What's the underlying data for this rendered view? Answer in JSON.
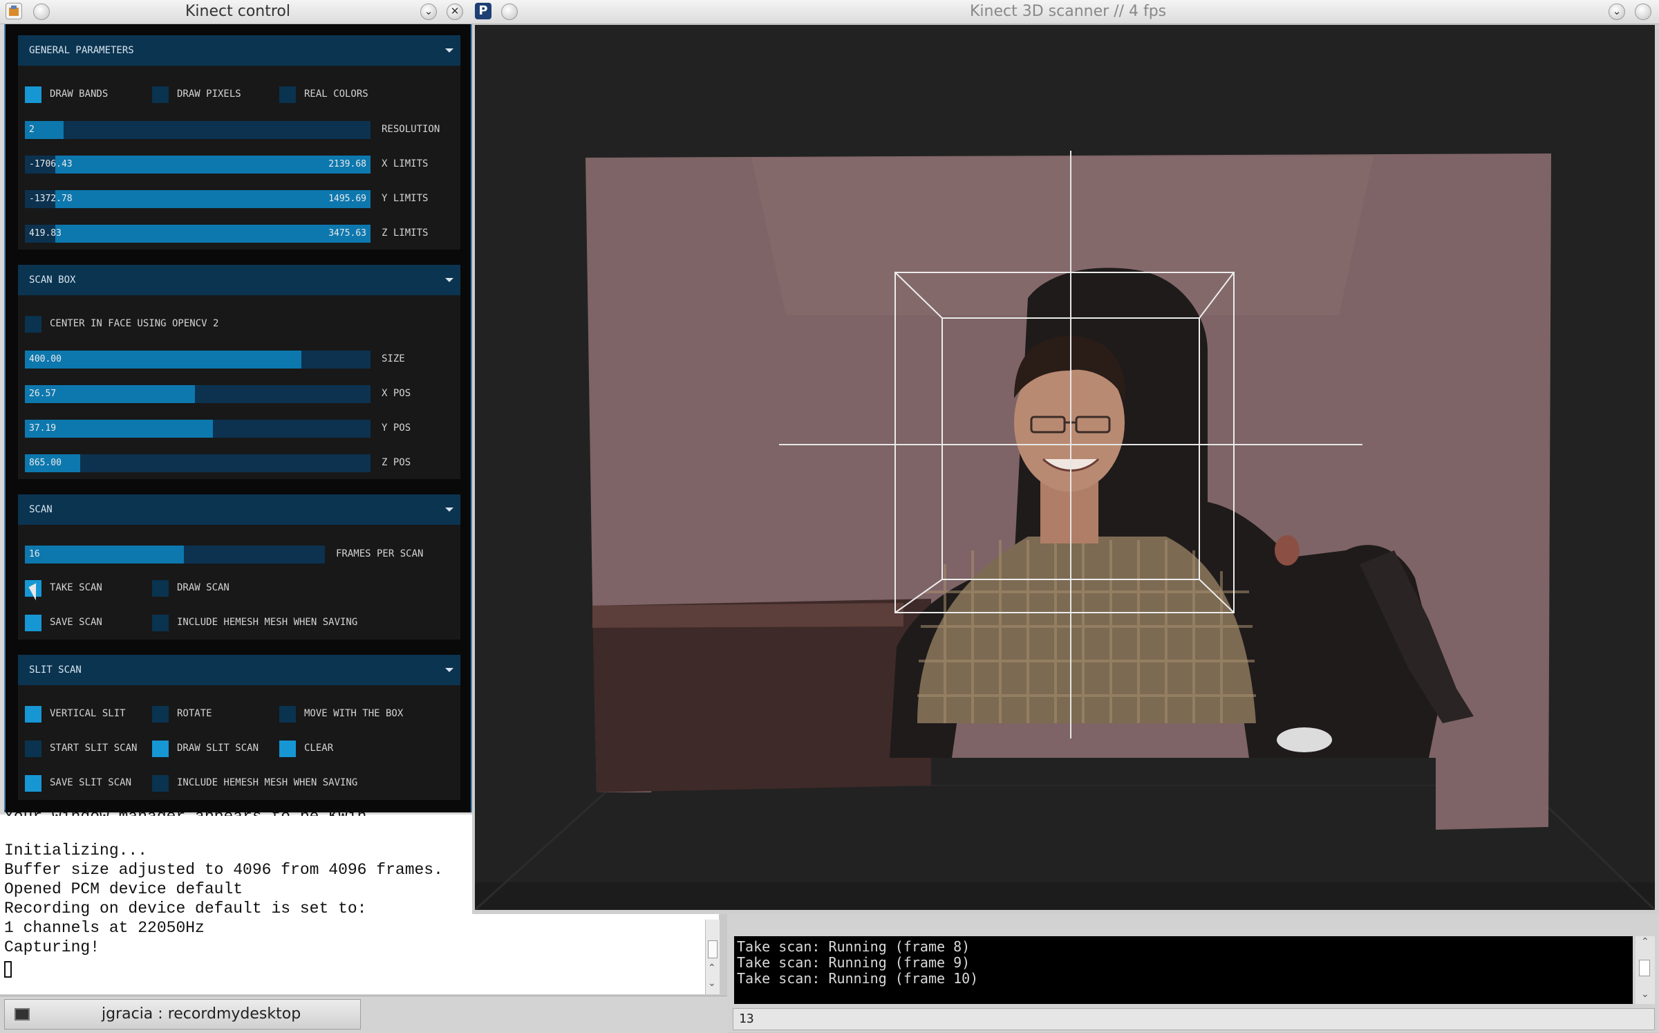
{
  "control_window": {
    "title": "Kinect control",
    "panels": {
      "general": {
        "title": "General parameters",
        "checkboxes": [
          {
            "label": "Draw bands",
            "checked": true
          },
          {
            "label": "Draw pixels",
            "checked": false
          },
          {
            "label": "Real colors",
            "checked": false
          }
        ],
        "resolution": {
          "label": "Resolution",
          "value": "2",
          "fill": 0.11
        },
        "x_limits": {
          "label": "X limits",
          "min": "-1706.43",
          "max": "2139.68"
        },
        "y_limits": {
          "label": "Y limits",
          "min": "-1372.78",
          "max": "1495.69"
        },
        "z_limits": {
          "label": "Z limits",
          "min": "419.83",
          "max": "3475.63"
        }
      },
      "scan_box": {
        "title": "Scan box",
        "center_face": {
          "label": "Center in face using OpenCV 2",
          "checked": false
        },
        "size": {
          "label": "Size",
          "value": "400.00",
          "fill": 0.8
        },
        "x_pos": {
          "label": "X pos",
          "value": "26.57",
          "fill": 0.49
        },
        "y_pos": {
          "label": "Y pos",
          "value": "37.19",
          "fill": 0.54
        },
        "z_pos": {
          "label": "Z pos",
          "value": "865.00",
          "fill": 0.16
        }
      },
      "scan": {
        "title": "Scan",
        "frames": {
          "label": "Frames per scan",
          "value": "16",
          "fill": 0.53
        },
        "checkboxes": [
          {
            "label": "Take scan",
            "checked": true
          },
          {
            "label": "Draw scan",
            "checked": false
          },
          {
            "label": "Save scan",
            "checked": true
          },
          {
            "label": "Include Hemesh mesh when saving",
            "checked": false
          }
        ]
      },
      "slit_scan": {
        "title": "Slit scan",
        "checkboxes": [
          {
            "label": "Vertical slit",
            "checked": true
          },
          {
            "label": "Rotate",
            "checked": false
          },
          {
            "label": "Move with the box",
            "checked": false
          },
          {
            "label": "Start slit scan",
            "checked": false
          },
          {
            "label": "Draw slit scan",
            "checked": true
          },
          {
            "label": "Clear",
            "checked": true
          },
          {
            "label": "Save slit scan",
            "checked": true
          },
          {
            "label": "Include Hemesh mesh when saving",
            "checked": false
          }
        ]
      }
    }
  },
  "terminal": {
    "cut_line": "Your window manager appears to be KWin",
    "lines": [
      "Initializing...",
      "Buffer size adjusted to 4096 from 4096 frames.",
      "Opened PCM device default",
      "Recording on device default is set to:",
      "1 channels at 22050Hz",
      "Capturing!"
    ]
  },
  "scanner_window": {
    "title": "Kinect 3D scanner // 4 fps"
  },
  "console": {
    "lines": [
      "Take scan: Running (frame 8)",
      "Take scan: Running (frame 9)",
      "Take scan: Running (frame 10)"
    ],
    "input_value": "13"
  },
  "taskbar": {
    "task_label": "jgracia : recordmydesktop"
  },
  "colors": {
    "panel_header": "#0b3451",
    "checkbox_on": "#1796d4",
    "checkbox_off": "#0a3350",
    "slider_fill": "#0d78ae",
    "slider_bg": "#0c3250",
    "wall": "#7e6466"
  },
  "icons": [
    "app-icon",
    "minimize-icon",
    "close-icon",
    "processing-icon",
    "terminal-icon"
  ]
}
